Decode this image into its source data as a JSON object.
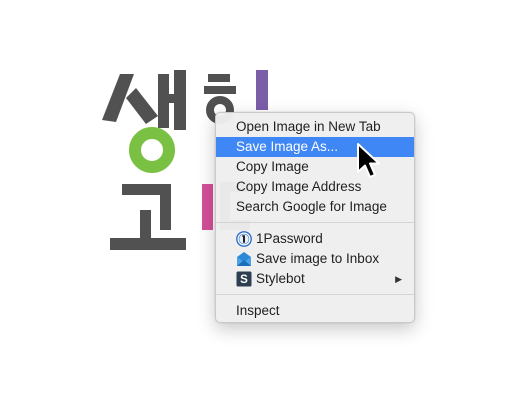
{
  "logo": {
    "text_line1": "생활",
    "text_line2": "코딩",
    "colors": {
      "dark": "#515151",
      "green": "#7ac143",
      "purple": "#7b5ea8",
      "pink": "#d4509a"
    }
  },
  "context_menu": {
    "items": [
      {
        "label": "Open Image in New Tab",
        "highlighted": false
      },
      {
        "label": "Save Image As...",
        "highlighted": true
      },
      {
        "label": "Copy Image",
        "highlighted": false
      },
      {
        "label": "Copy Image Address",
        "highlighted": false
      },
      {
        "label": "Search Google for Image",
        "highlighted": false
      }
    ],
    "extension_items": [
      {
        "label": "1Password",
        "icon": "1password-icon"
      },
      {
        "label": "Save image to Inbox",
        "icon": "inbox-icon"
      },
      {
        "label": "Stylebot",
        "icon": "stylebot-icon",
        "submenu": true
      }
    ],
    "footer_items": [
      {
        "label": "Inspect"
      }
    ],
    "highlight_color": "#3e87f4"
  },
  "cursor": {
    "icon": "arrow-cursor-icon"
  }
}
